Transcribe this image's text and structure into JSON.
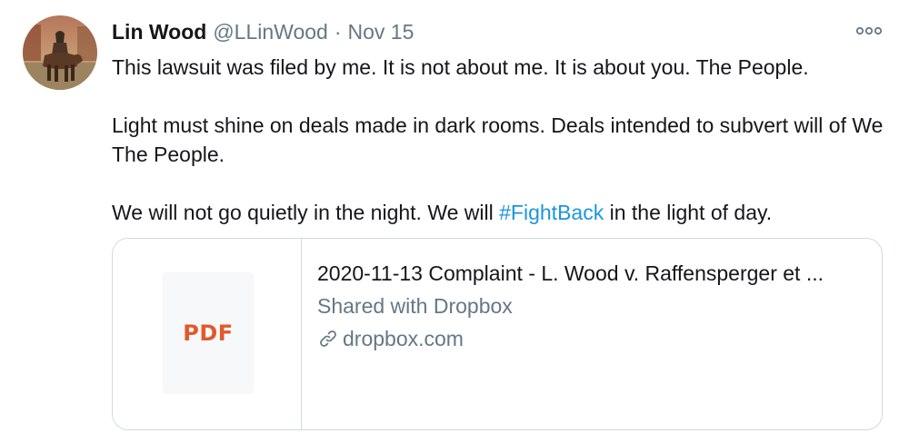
{
  "tweet": {
    "author": {
      "display_name": "Lin Wood",
      "handle": "@LLinWood",
      "avatar_icon": "avatar-horse-rider"
    },
    "separator": "·",
    "date": "Nov 15",
    "more_icon": "more-options-icon",
    "body": {
      "p1": "This lawsuit was filed by me. It is not about me. It is about you. The People.",
      "p2": "Light must shine on deals made in dark rooms. Deals intended to subvert will of We The People.",
      "p3_before": "We will not go quietly in the night. We will ",
      "p3_hashtag": "#FightBack",
      "p3_after": " in the light of day."
    },
    "card": {
      "thumbnail_label": "PDF",
      "thumbnail_color": "#e05a2b",
      "title": "2020-11-13 Complaint - L. Wood v. Raffensperger et ...",
      "description": "Shared with Dropbox",
      "domain": "dropbox.com",
      "domain_icon": "link-icon"
    }
  },
  "colors": {
    "text_primary": "#14171a",
    "text_secondary": "#657786",
    "hashtag": "#1b95e0",
    "border": "#cfd9de"
  }
}
